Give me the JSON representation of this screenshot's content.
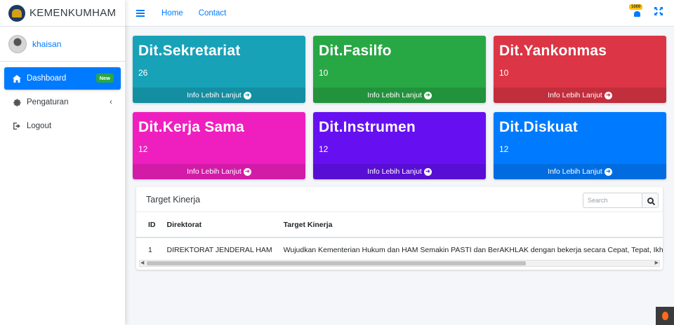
{
  "brand": {
    "name": "KEMENKUMHAM"
  },
  "user": {
    "name": "khaisan"
  },
  "sidebar": {
    "items": [
      {
        "label": "Dashboard",
        "icon": "home-icon",
        "badge": "New",
        "active": true
      },
      {
        "label": "Pengaturan",
        "icon": "gear-icon"
      },
      {
        "label": "Logout",
        "icon": "logout-icon"
      }
    ]
  },
  "navbar": {
    "links": [
      "Home",
      "Contact"
    ],
    "notification_count": "1000"
  },
  "info_boxes": [
    {
      "title": "Dit.Sekretariat",
      "count": "26",
      "footer": "Info Lebih Lanjut",
      "color": "#17a2b8"
    },
    {
      "title": "Dit.Fasilfo",
      "count": "10",
      "footer": "Info Lebih Lanjut",
      "color": "#28a745"
    },
    {
      "title": "Dit.Yankonmas",
      "count": "10",
      "footer": "Info Lebih Lanjut",
      "color": "#dc3545"
    },
    {
      "title": "Dit.Kerja Sama",
      "count": "12",
      "footer": "Info Lebih Lanjut",
      "color": "#ef1fbf"
    },
    {
      "title": "Dit.Instrumen",
      "count": "12",
      "footer": "Info Lebih Lanjut",
      "color": "#6610f2"
    },
    {
      "title": "Dit.Diskuat",
      "count": "12",
      "footer": "Info Lebih Lanjut",
      "color": "#007bff"
    }
  ],
  "table_card": {
    "title": "Target Kinerja",
    "search_placeholder": "Search",
    "columns": [
      "ID",
      "Direktorat",
      "Target Kinerja"
    ],
    "rows": [
      [
        "1",
        "DIREKTORAT JENDERAL HAM",
        "Wujudkan Kementerian Hukum dan HAM Semakin PASTI dan BerAKHLAK dengan bekerja secara Cepat, Tepat, Ikhlas"
      ]
    ]
  }
}
